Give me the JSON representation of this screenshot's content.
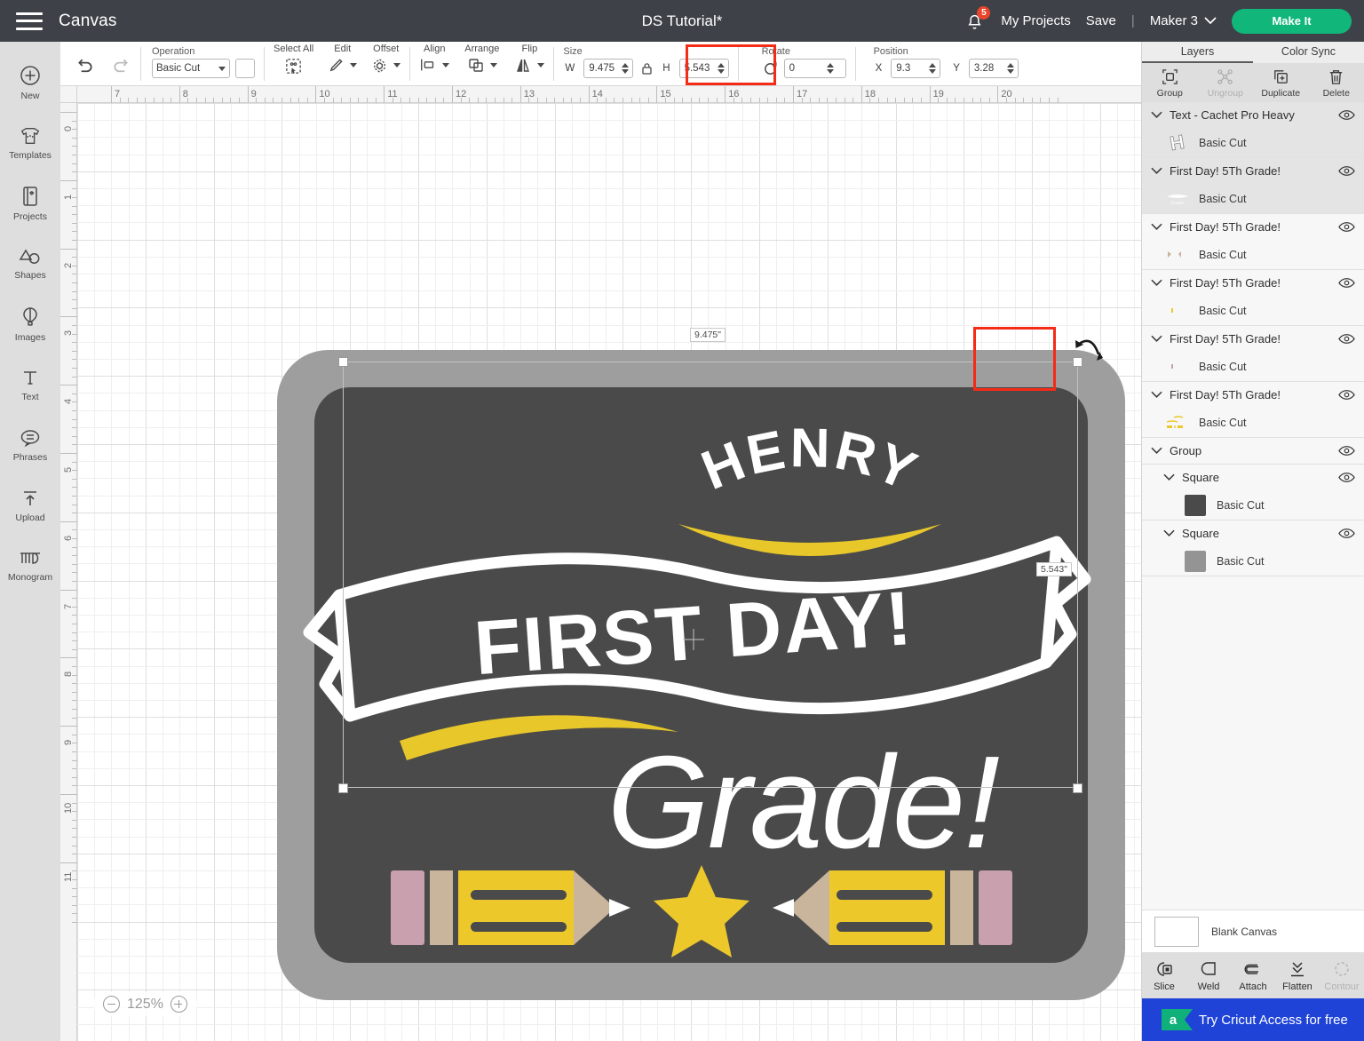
{
  "topbar": {
    "menu_icon": "hamburger-icon",
    "canvas_label": "Canvas",
    "document_title": "DS Tutorial*",
    "notifications_icon": "bell-icon",
    "notification_count": "5",
    "my_projects": "My Projects",
    "save": "Save",
    "separator": "|",
    "machine": "Maker 3",
    "machine_caret": "chevron-down-icon",
    "make_it": "Make It",
    "accent_green": "#11b67a",
    "bar_bg": "#3e4248"
  },
  "rail": {
    "items": [
      {
        "label": "New",
        "icon": "plus-circle-icon"
      },
      {
        "label": "Templates",
        "icon": "tshirt-icon"
      },
      {
        "label": "Projects",
        "icon": "projects-card-icon"
      },
      {
        "label": "Shapes",
        "icon": "shapes-icon"
      },
      {
        "label": "Images",
        "icon": "hot-air-balloon-icon"
      },
      {
        "label": "Text",
        "icon": "text-t-icon"
      },
      {
        "label": "Phrases",
        "icon": "speech-bubble-icon"
      },
      {
        "label": "Upload",
        "icon": "upload-arrow-icon"
      },
      {
        "label": "Monogram",
        "icon": "monogram-icon"
      }
    ]
  },
  "toolbar": {
    "undo_icon": "undo-arrow-icon",
    "redo_icon": "redo-arrow-icon",
    "operation_label": "Operation",
    "operation_value": "Basic Cut",
    "operation_color": "#ffffff",
    "select_all": "Select All",
    "select_all_icon": "select-all-icon",
    "edit": "Edit",
    "edit_icon": "pencil-icon",
    "offset": "Offset",
    "offset_icon": "offset-icon",
    "align": "Align",
    "align_icon": "align-icon",
    "arrange": "Arrange",
    "arrange_icon": "arrange-icon",
    "flip": "Flip",
    "flip_icon": "flip-icon",
    "size_label": "Size",
    "w_label": "W",
    "w_value": "9.475",
    "h_label": "H",
    "h_value": "5.543",
    "lock_icon": "lock-icon",
    "rotate_label": "Rotate",
    "rotate_icon": "rotate-icon",
    "rotate_value": "0",
    "position_label": "Position",
    "x_label": "X",
    "x_value": "9.3",
    "y_label": "Y",
    "y_value": "3.28",
    "highlight_color": "#f42b16"
  },
  "canvas": {
    "zoom_level": "125%",
    "zoom_out_icon": "minus-circle-icon",
    "zoom_in_icon": "plus-circle-icon",
    "ruler_h_ticks": [
      "7",
      "8",
      "9",
      "10",
      "11",
      "12",
      "13",
      "14",
      "15",
      "16",
      "17",
      "18",
      "19",
      "20"
    ],
    "ruler_v_ticks": [
      "0",
      "1",
      "2",
      "3",
      "4",
      "5",
      "6",
      "7",
      "8",
      "9",
      "10",
      "11"
    ],
    "selection": {
      "width_label": "9.475\"",
      "height_label": "5.543\"",
      "rotate_handle_icon": "rotate-handle-icon"
    },
    "artwork": {
      "name_text": "HENRY",
      "banner_text": "FIRST DAY!",
      "grade_text": "Grade!",
      "board_frame_color": "#9e9e9e",
      "board_color": "#4a4a4a",
      "ink_white": "#ffffff",
      "ink_yellow": "#e8c72b",
      "pencil_body": "#ecc82b",
      "pencil_ferrule": "#c9b49c",
      "pencil_eraser": "#c9a0ad",
      "star_color": "#ecc82b"
    }
  },
  "right_panel": {
    "tabs": [
      {
        "label": "Layers",
        "active": true
      },
      {
        "label": "Color Sync",
        "active": false
      }
    ],
    "actions": [
      {
        "label": "Group",
        "icon": "group-icon",
        "disabled": false
      },
      {
        "label": "Ungroup",
        "icon": "ungroup-icon",
        "disabled": true
      },
      {
        "label": "Duplicate",
        "icon": "duplicate-icon",
        "disabled": false
      },
      {
        "label": "Delete",
        "icon": "trash-icon",
        "disabled": false
      }
    ],
    "layers": [
      {
        "title": "Text - Cachet Pro Heavy",
        "selected": true,
        "thumb": "glyph-h",
        "child_label": "Basic Cut"
      },
      {
        "title": "First Day! 5Th Grade!",
        "selected": true,
        "thumb": "faint-art",
        "child_label": "Basic Cut"
      },
      {
        "title": "First Day! 5Th Grade!",
        "selected": false,
        "thumb": "tan-marks",
        "child_label": "Basic Cut"
      },
      {
        "title": "First Day! 5Th Grade!",
        "selected": false,
        "thumb": "tiny-yellow",
        "child_label": "Basic Cut"
      },
      {
        "title": "First Day! 5Th Grade!",
        "selected": false,
        "thumb": "tiny-pink",
        "child_label": "Basic Cut"
      },
      {
        "title": "First Day! 5Th Grade!",
        "selected": false,
        "thumb": "yellow-marks",
        "child_label": "Basic Cut"
      }
    ],
    "group": {
      "title": "Group",
      "squares": [
        {
          "title": "Square",
          "color": "#4a4a4a",
          "child_label": "Basic Cut"
        },
        {
          "title": "Square",
          "color": "#949494",
          "child_label": "Basic Cut"
        }
      ]
    },
    "eye_icon": "eye-icon",
    "chevron_icon": "chevron-down-icon",
    "canvas_row": {
      "label": "Blank Canvas",
      "swatch_color": "#ffffff"
    },
    "operations": [
      {
        "label": "Slice",
        "icon": "slice-icon",
        "disabled": false
      },
      {
        "label": "Weld",
        "icon": "weld-icon",
        "disabled": false
      },
      {
        "label": "Attach",
        "icon": "attach-paperclip-icon",
        "disabled": false
      },
      {
        "label": "Flatten",
        "icon": "flatten-icon",
        "disabled": false
      },
      {
        "label": "Contour",
        "icon": "contour-icon",
        "disabled": true
      }
    ],
    "promo": {
      "text": "Try Cricut Access for free",
      "badge": "a",
      "bg": "#1f43d6"
    }
  }
}
